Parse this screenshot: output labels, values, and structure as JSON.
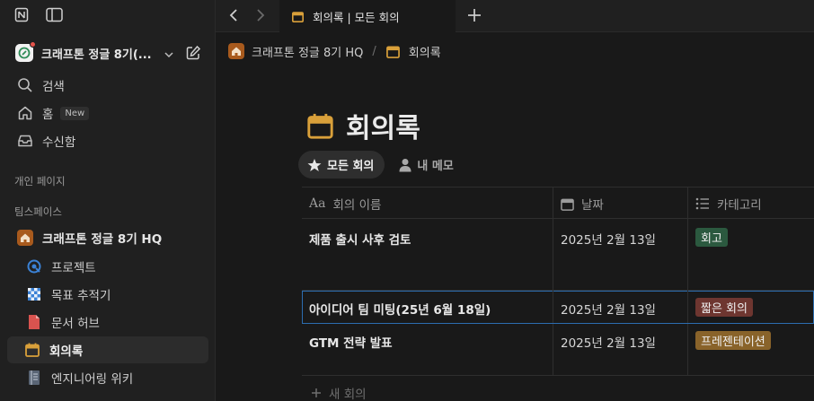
{
  "sidebar": {
    "workspace_name": "크래프톤 정글 8기(...",
    "nav": {
      "search": "검색",
      "home": "홈",
      "home_badge": "New",
      "inbox": "수신함"
    },
    "section_private": "개인 페이지",
    "section_teamspace": "팀스페이스",
    "teamspace_name": "크래프톤 정글 8기 HQ",
    "pages": [
      {
        "label": "프로젝트",
        "icon": "projects-icon"
      },
      {
        "label": "목표 추적기",
        "icon": "checkered-flag-icon"
      },
      {
        "label": "문서 허브",
        "icon": "document-icon"
      },
      {
        "label": "회의록",
        "icon": "calendar-icon"
      },
      {
        "label": "엔지니어링 위키",
        "icon": "wiki-icon"
      }
    ]
  },
  "tabbar": {
    "tab_title": "회의록 | 모든 회의"
  },
  "breadcrumb": {
    "items": [
      "크래프톤 정글 8기 HQ",
      "회의록"
    ],
    "separator": "/"
  },
  "page": {
    "title": "회의록",
    "views": [
      "모든 회의",
      "내 메모"
    ]
  },
  "table": {
    "columns": [
      "회의 이름",
      "날짜",
      "카테고리"
    ],
    "rows": [
      {
        "name": "제품 출시 사후 검토",
        "date": "2025년 2월 13일",
        "category": "회고",
        "category_color": "#2b593f"
      },
      {
        "name": "아이디어 팀 미팅(25년 6월 18일)",
        "date": "2025년 2월 13일",
        "category": "짧은 회의",
        "category_color": "#6e3630"
      },
      {
        "name": "GTM 전략 발표",
        "date": "2025년 2월 13일",
        "category": "프레젠테이션",
        "category_color": "#89632a"
      }
    ],
    "new_row_label": "새 회의"
  },
  "colors": {
    "accent_calendar": "#d9a03a",
    "selection_border": "#2c6db0"
  }
}
